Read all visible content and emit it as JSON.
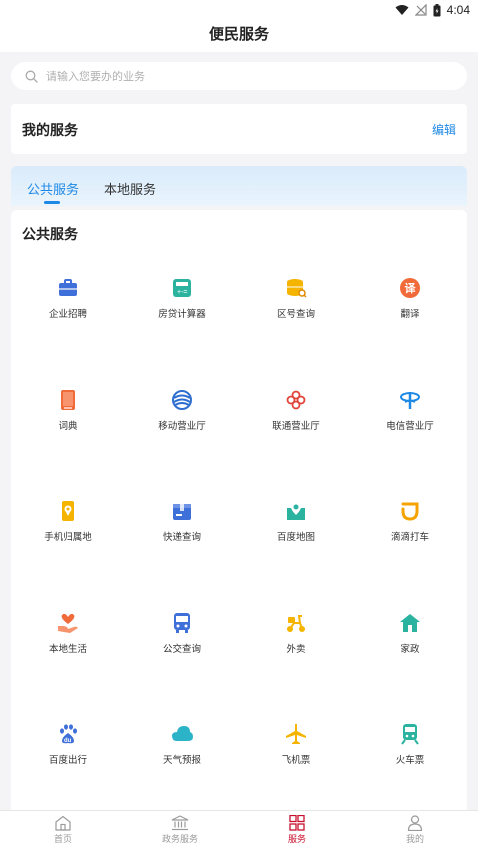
{
  "status_bar": {
    "time": "4:04"
  },
  "header": {
    "title": "便民服务"
  },
  "search": {
    "placeholder": "请输入您要办的业务"
  },
  "my_services": {
    "label": "我的服务",
    "edit_label": "编辑"
  },
  "tabs": [
    {
      "label": "公共服务",
      "active": true
    },
    {
      "label": "本地服务",
      "active": false
    }
  ],
  "section": {
    "title": "公共服务"
  },
  "services": [
    {
      "name": "企业招聘",
      "icon": "briefcase-icon",
      "color": "#3f6fd8"
    },
    {
      "name": "房贷计算器",
      "icon": "calculator-icon",
      "color": "#2bb3a0"
    },
    {
      "name": "区号查询",
      "icon": "database-search-icon",
      "color": "#f5b400"
    },
    {
      "name": "翻译",
      "icon": "translate-icon",
      "color": "#f06a3a"
    },
    {
      "name": "词典",
      "icon": "book-icon",
      "color": "#f06a3a"
    },
    {
      "name": "移动营业厅",
      "icon": "china-mobile-icon",
      "color": "#2f6fd0"
    },
    {
      "name": "联通营业厅",
      "icon": "china-unicom-icon",
      "color": "#e0443a"
    },
    {
      "name": "电信营业厅",
      "icon": "china-telecom-icon",
      "color": "#1e88e5"
    },
    {
      "name": "手机归属地",
      "icon": "phone-location-icon",
      "color": "#f5b400"
    },
    {
      "name": "快递查询",
      "icon": "package-icon",
      "color": "#3f6fd8"
    },
    {
      "name": "百度地图",
      "icon": "map-pin-icon",
      "color": "#2bb3a0"
    },
    {
      "name": "滴滴打车",
      "icon": "didi-icon",
      "color": "#f5a300"
    },
    {
      "name": "本地生活",
      "icon": "hand-heart-icon",
      "color": "#f06a3a"
    },
    {
      "name": "公交查询",
      "icon": "bus-icon",
      "color": "#3f6fd8"
    },
    {
      "name": "外卖",
      "icon": "scooter-icon",
      "color": "#f5b400"
    },
    {
      "name": "家政",
      "icon": "house-cleaning-icon",
      "color": "#2bb3a0"
    },
    {
      "name": "百度出行",
      "icon": "baidu-paw-icon",
      "color": "#3f6fd8"
    },
    {
      "name": "天气预报",
      "icon": "cloud-icon",
      "color": "#2bb3c8"
    },
    {
      "name": "飞机票",
      "icon": "airplane-icon",
      "color": "#f5b400"
    },
    {
      "name": "火车票",
      "icon": "train-icon",
      "color": "#2bb3a0"
    }
  ],
  "bottom_nav": [
    {
      "label": "首页",
      "icon": "home-icon",
      "active": false
    },
    {
      "label": "政务服务",
      "icon": "government-icon",
      "active": false
    },
    {
      "label": "服务",
      "icon": "grid-icon",
      "active": true
    },
    {
      "label": "我的",
      "icon": "user-icon",
      "active": false
    }
  ],
  "colors": {
    "accent": "#1e88e5",
    "active_nav": "#c8102e"
  }
}
